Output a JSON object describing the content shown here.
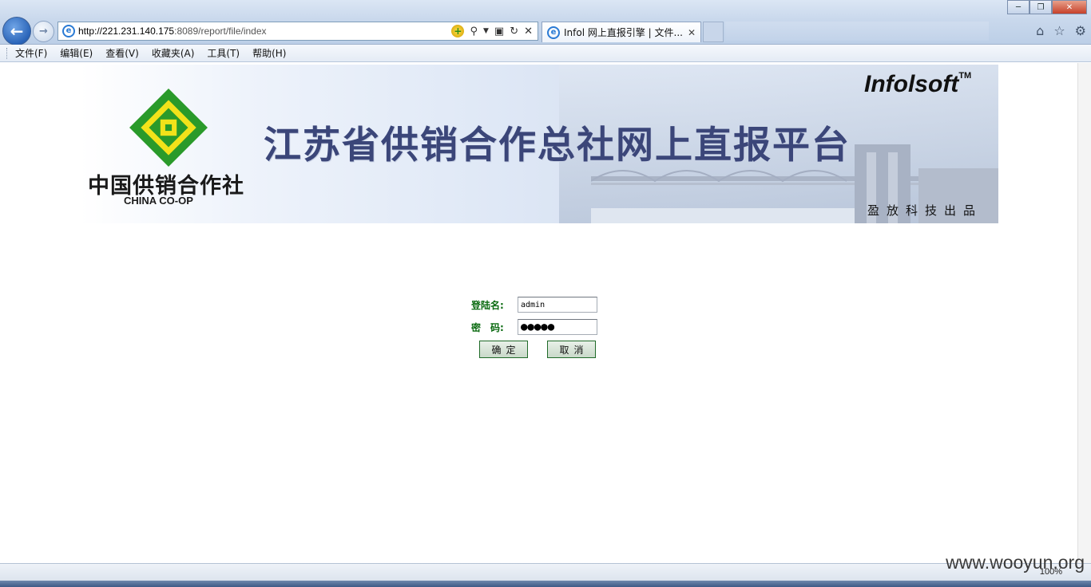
{
  "browser": {
    "url": "http://221.231.140.175:8089/report/file/index",
    "url_host": "http://221.231.140.175",
    "url_rest": ":8089/report/file/index",
    "tab_title": "Infol 网上直报引擎 | 文件...",
    "zoom": "100%"
  },
  "menu": {
    "items": [
      "文件(F)",
      "编辑(E)",
      "查看(V)",
      "收藏夹(A)",
      "工具(T)",
      "帮助(H)"
    ]
  },
  "banner": {
    "logo_cn": "中国供销合作社",
    "logo_en": "CHINA CO-OP",
    "title": "江苏省供销合作总社网上直报平台",
    "brand": "Infolsoft",
    "brand_tm": "TM",
    "producer": "盈放科技出品"
  },
  "login": {
    "username_label": "登陆名:",
    "username_value": "admin",
    "password_label": "密　码:",
    "password_mask": "●●●●●",
    "confirm_label": "确定",
    "cancel_label": "取消"
  },
  "watermark": "www.wooyun.org",
  "colors": {
    "title": "#3b4679",
    "label_green": "#0a6a10",
    "logo_green": "#2a9a2a",
    "logo_yellow": "#f2e21a"
  }
}
